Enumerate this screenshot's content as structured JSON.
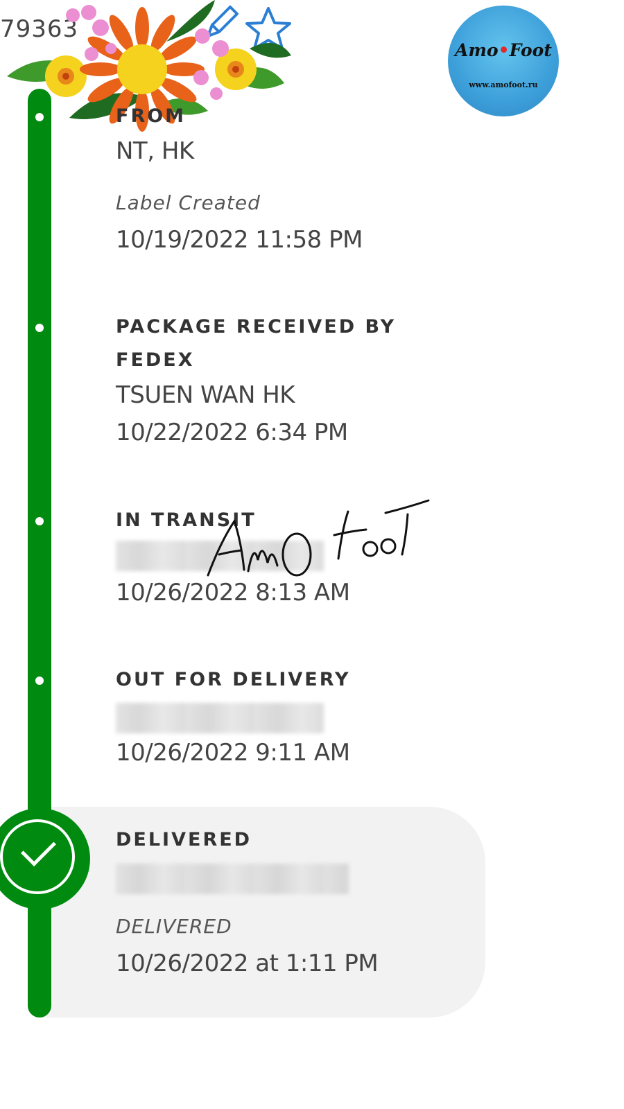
{
  "header": {
    "tracking_number": "79363",
    "edit_icon": "pencil-icon",
    "favorite_icon": "star-icon"
  },
  "logo": {
    "name_part1": "Amo",
    "name_part2": "Foot",
    "url": "www.amofoot.ru"
  },
  "colors": {
    "timeline": "#008a10",
    "card": "#f2f2f2",
    "text": "#444444"
  },
  "events": [
    {
      "heading": "FROM",
      "location": "NT, HK",
      "status_label": "Label Created",
      "datetime": "10/19/2022 11:58 PM"
    },
    {
      "heading_line1": "PACKAGE RECEIVED BY",
      "heading_line2": "FEDEX",
      "location": "TSUEN WAN HK",
      "datetime": "10/22/2022 6:34 PM"
    },
    {
      "heading": "IN TRANSIT",
      "datetime": "10/26/2022 8:13 AM"
    },
    {
      "heading": "OUT FOR DELIVERY",
      "datetime": "10/26/2022 9:11 AM"
    },
    {
      "heading": "DELIVERED",
      "status_label": "DELIVERED",
      "datetime": "10/26/2022 at 1:11 PM",
      "icon": "check-circle-icon"
    }
  ],
  "watermark": {
    "text": "AmO Foot"
  }
}
